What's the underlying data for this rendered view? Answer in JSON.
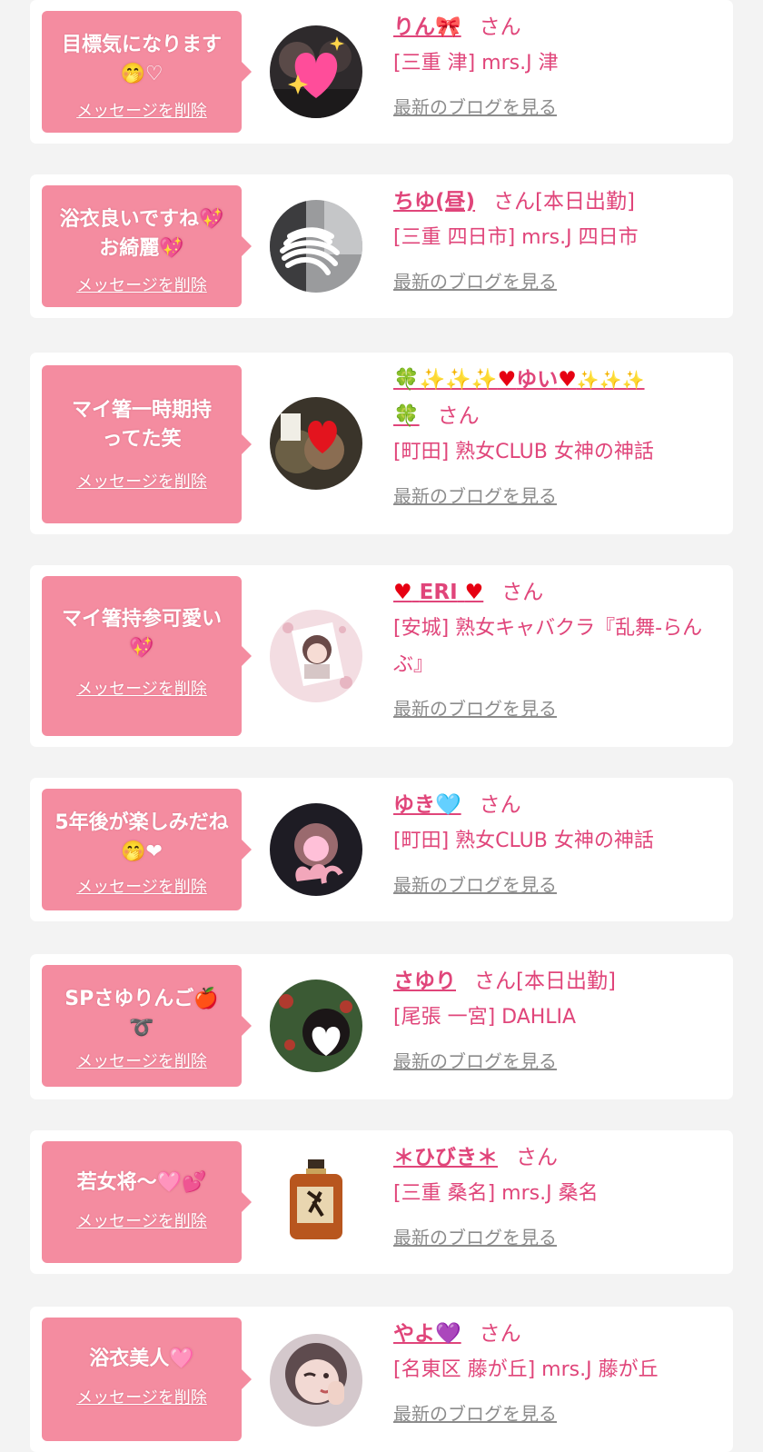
{
  "san_label": "さん",
  "delete_label": "メッセージを削除",
  "blog_label": "最新のブログを見る",
  "cards": [
    {
      "message_text": "目標気になります",
      "message_emoji": "🤭♡",
      "name_text": "りん",
      "name_emoji": "🎀",
      "name_suffix": "",
      "shop": "[三重 津] mrs.J 津",
      "avatar_icon": "sparkle-heart"
    },
    {
      "message_text": "浴衣良いですね",
      "message_emoji": "💖",
      "message_text2": "お綺麗",
      "message_emoji2": "💖",
      "name_text": "ちゆ(昼)",
      "name_emoji": "",
      "name_suffix": "[本日出勤]",
      "shop": "[三重 四日市] mrs.J 四日市",
      "avatar_icon": "scribble"
    },
    {
      "message_text": "マイ箸一時期持ってた笑",
      "name_text": "ゆい",
      "name_prefix": "🍀✨✨✨",
      "name_heart": "♥",
      "name_after": "✨✨✨",
      "name_tail": "🍀",
      "name_suffix": "",
      "shop": "[町田] 熟女CLUB 女神の神話",
      "avatar_icon": "red-heart"
    },
    {
      "message_text": "マイ箸持参可愛い",
      "message_emoji": "💖",
      "name_text": "ERI",
      "name_heart": "♥",
      "name_suffix": "",
      "shop": "[安城] 熟女キャバクラ『乱舞-らんぶ』",
      "avatar_icon": "photo-frame"
    },
    {
      "message_text": "5年後が楽しみだね",
      "message_emoji": "🤭❤",
      "name_text": "ゆき",
      "name_emoji": "🩵",
      "name_suffix": "",
      "shop": "[町田] 熟女CLUB 女神の神話",
      "avatar_icon": "blur-face"
    },
    {
      "message_text": "SPさゆりんご",
      "message_emoji": "🍎",
      "message_emoji2": "➰",
      "name_text": "さゆり",
      "name_emoji": "",
      "name_suffix": "[本日出勤]",
      "shop": "[尾張 一宮] DAHLIA",
      "avatar_icon": "heart-face"
    },
    {
      "message_text": "若女将〜",
      "message_emoji": "🩷💕",
      "name_text": "＊ひびき＊",
      "name_emoji": "",
      "name_suffix": "",
      "shop": "[三重 桑名] mrs.J 桑名",
      "avatar_icon": "whisky-bottle"
    },
    {
      "message_text": "浴衣美人",
      "message_emoji": "🩷",
      "name_text": "やよ",
      "name_emoji": "💜",
      "name_suffix": "",
      "shop": "[名東区 藤が丘] mrs.J 藤が丘",
      "avatar_icon": "wink-face"
    }
  ]
}
